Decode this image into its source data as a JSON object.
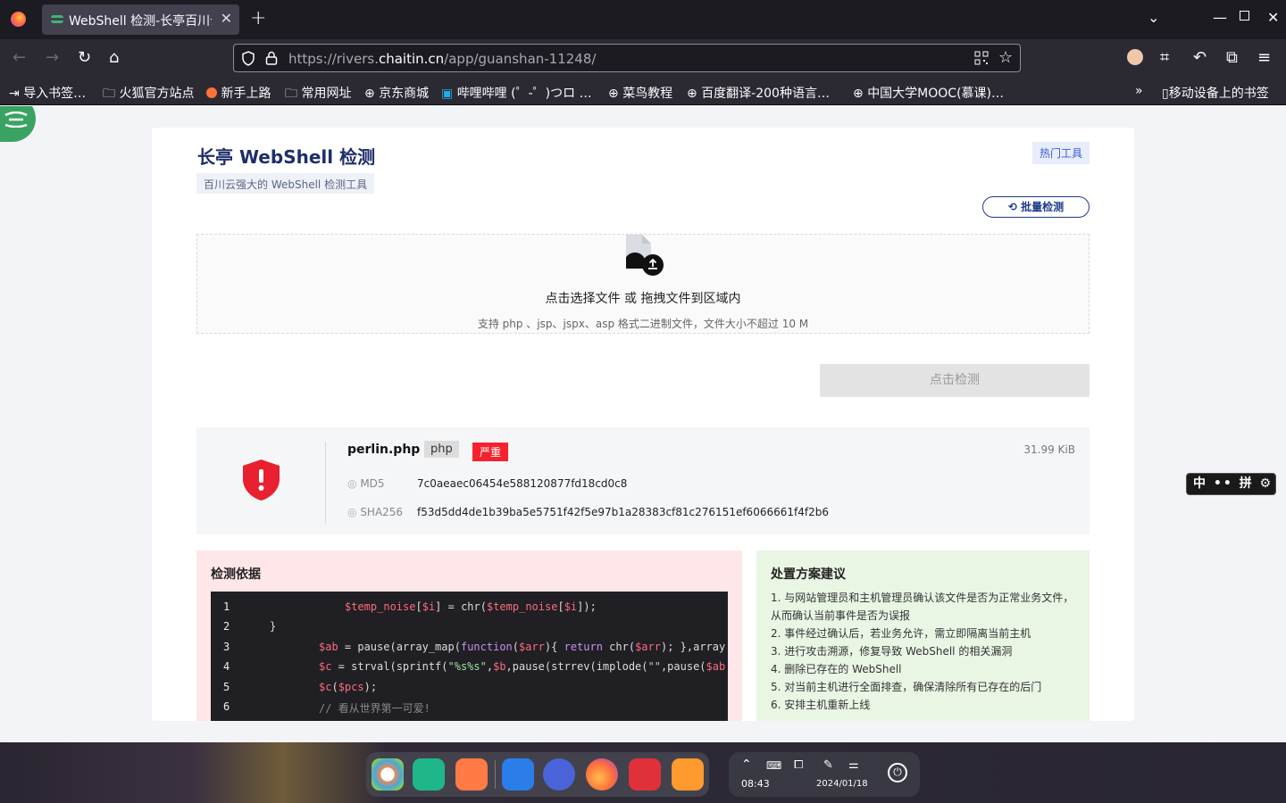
{
  "browser": {
    "tab_title": "WebShell 检测-长亭百川云",
    "url_prefix": "https://rivers.",
    "url_domain": "chaitin.cn",
    "url_path": "/app/guanshan-11248/"
  },
  "bookmarks": [
    {
      "label": "导入书签…",
      "icon": "import-icon"
    },
    {
      "label": "火狐官方站点",
      "icon": "folder-icon"
    },
    {
      "label": "新手上路",
      "icon": "firefox-icon"
    },
    {
      "label": "常用网址",
      "icon": "folder-icon"
    },
    {
      "label": "京东商城",
      "icon": "globe-icon"
    },
    {
      "label": "哔哩哔哩 (゜-゜)つロ …",
      "icon": "bilibili-icon"
    },
    {
      "label": "菜鸟教程",
      "icon": "globe-icon"
    },
    {
      "label": "百度翻译-200种语言…",
      "icon": "globe-icon"
    },
    {
      "label": "中国大学MOOC(慕课)…",
      "icon": "globe-icon"
    },
    {
      "label": "移动设备上的书签",
      "icon": "mobile-icon"
    }
  ],
  "page": {
    "title": "长亭 WebShell 检测",
    "subtitle": "百川云强大的 WebShell 检测工具",
    "hot_tag": "热门工具",
    "batch_button": "批量检测",
    "upload_title": "点击选择文件 或 拖拽文件到区域内",
    "upload_hint": "支持 php 、jsp、jspx、asp 格式二进制文件，文件大小不超过 10 M",
    "detect_button": "点击检测"
  },
  "result": {
    "filename": "perlin.php",
    "type_tag": "php",
    "severity": "严重",
    "size": "31.99 KiB",
    "md5_label": "MD5",
    "md5": "7c0aeaec06454e588120877fd18cd0c8",
    "sha256_label": "SHA256",
    "sha256": "f53d5dd4de1b39ba5e5751f42f5e97b1a28383cf81c276151ef6066661f4f2b6",
    "accent": "#e8202f"
  },
  "basis": {
    "title": "检测依据",
    "line_numbers": [
      "1",
      "2",
      "3",
      "4",
      "5",
      "6"
    ]
  },
  "advice": {
    "title": "处置方案建议",
    "items": [
      "1. 与网站管理员和主机管理员确认该文件是否为正常业务文件，从而确认当前事件是否为误报",
      "2. 事件经过确认后，若业务允许，需立即隔离当前主机",
      "3. 进行攻击溯源，修复导致 WebShell 的相关漏洞",
      "4. 删除已存在的 WebShell",
      "5. 对当前主机进行全面排查，确保清除所有已存在的后门",
      "6. 安排主机重新上线"
    ]
  },
  "ime": {
    "label": "中 •• 拼 ⚙"
  },
  "taskbar": {
    "time": "08:43",
    "date": "2024/01/18"
  }
}
